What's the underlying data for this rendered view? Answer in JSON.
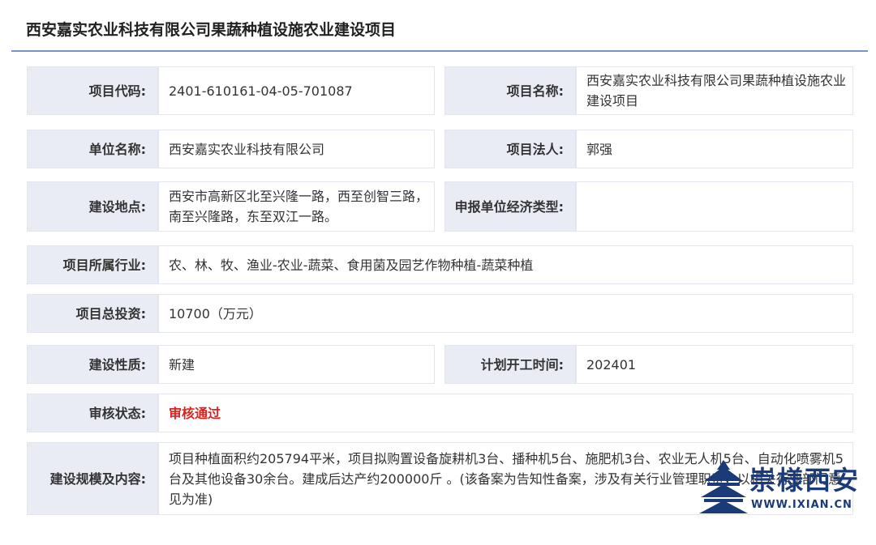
{
  "title": "西安嘉实农业科技有限公司果蔬种植设施农业建设项目",
  "rows": {
    "project_code": {
      "label": "项目代码:",
      "value": "2401-610161-04-05-701087"
    },
    "project_name": {
      "label": "项目名称:",
      "value": "西安嘉实农业科技有限公司果蔬种植设施农业建设项目"
    },
    "unit_name": {
      "label": "单位名称:",
      "value": "西安嘉实农业科技有限公司"
    },
    "legal_person": {
      "label": "项目法人:",
      "value": "郭强"
    },
    "location": {
      "label": "建设地点:",
      "value": "西安市高新区北至兴隆一路，西至创智三路，南至兴隆路，东至双江一路。"
    },
    "economic_type": {
      "label": "申报单位经济类型:",
      "value": ""
    },
    "industry": {
      "label": "项目所属行业:",
      "value": "农、林、牧、渔业-农业-蔬菜、食用菌及园艺作物种植-蔬菜种植"
    },
    "investment": {
      "label": "项目总投资:",
      "value": "10700（万元）"
    },
    "nature": {
      "label": "建设性质:",
      "value": "新建"
    },
    "start_time": {
      "label": "计划开工时间:",
      "value": "202401"
    },
    "review_status": {
      "label": "审核状态:",
      "value": "审核通过",
      "color": "#e0201e"
    },
    "scale": {
      "label": "建设规模及内容:",
      "value": "项目种植面积约205794平米，项目拟购置设备旋耕机3台、播种机5台、施肥机3台、农业无人机5台、自动化喷雾机5台及其他设备30余台。建成后达产约200000斤 。(该备案为告知性备案，涉及有关行业管理职责，以相关行业部门意见为准)"
    }
  },
  "watermark": {
    "text": "崇様西安",
    "url": "WWW.IXIAN.CN"
  },
  "colors": {
    "label_bg": "#e9ecf5",
    "title_underline": "#7a93c9",
    "brand": "#1a3a78"
  }
}
